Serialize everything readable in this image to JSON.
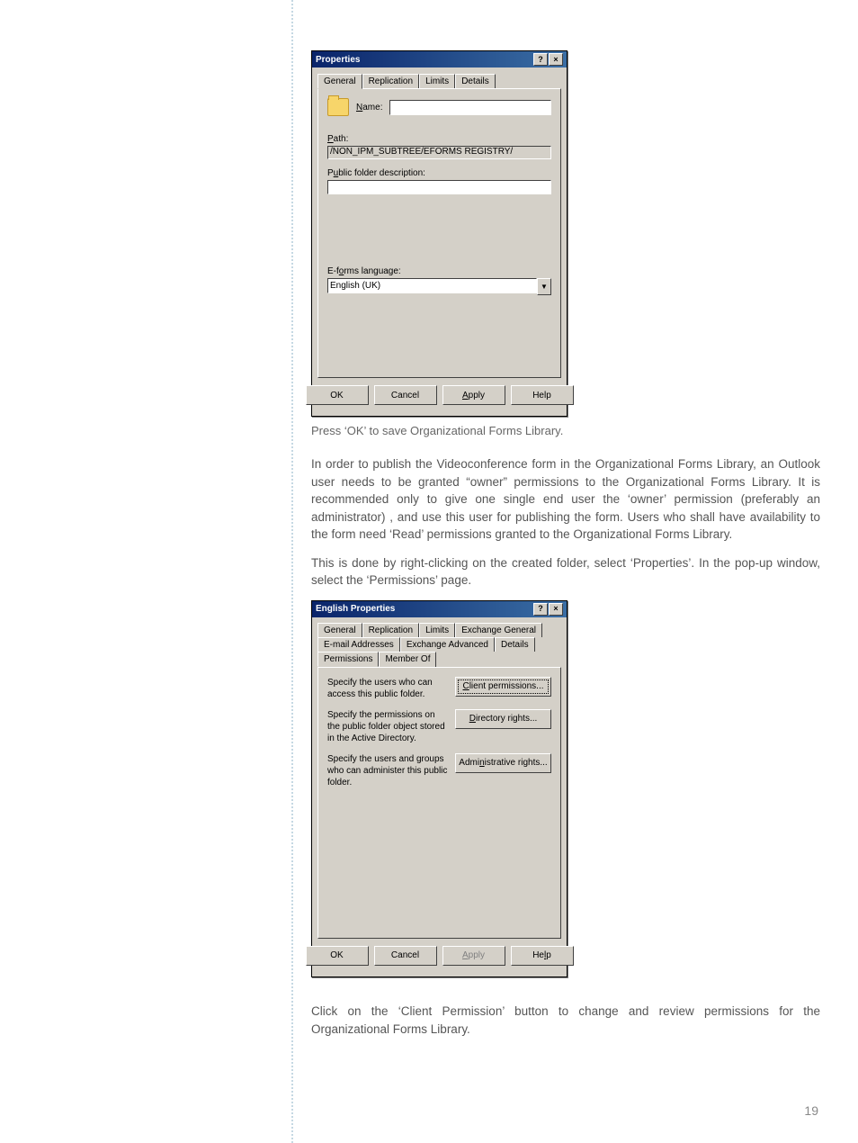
{
  "dialog1": {
    "title": "Properties",
    "tabs": [
      "General",
      "Replication",
      "Limits",
      "Details"
    ],
    "name_label": "Name:",
    "name_value": "",
    "path_label": "Path:",
    "path_value": "/NON_IPM_SUBTREE/EFORMS REGISTRY/",
    "desc_label": "Public folder description:",
    "desc_value": "",
    "lang_label": "E-forms language:",
    "lang_value": "English (UK)",
    "ok": "OK",
    "cancel": "Cancel",
    "apply": "Apply",
    "help": "Help"
  },
  "caption1": "Press ‘OK’ to save Organizational Forms Library.",
  "para1": "In order to publish the Videoconference form in the Organizational Forms Library, an Outlook user needs to be granted “owner” permissions to the Organizational Forms Library. It is recommended only to give one single end user the ‘owner’ permission (preferably an administrator) , and use this user for publishing the form. Users who shall have availability to the form need ‘Read’ permissions granted to the Organizational Forms Library.",
  "para2": "This is done by right-clicking on the created folder, select ‘Properties’. In the pop-up window, select the ‘Permissions’ page.",
  "dialog2": {
    "title": "English Properties",
    "tabs_row1": [
      "General",
      "Replication",
      "Limits",
      "Exchange General"
    ],
    "tabs_row2": [
      "E-mail Addresses",
      "Exchange Advanced",
      "Details",
      "Permissions",
      "Member Of"
    ],
    "row1_text": "Specify the users who can access this public folder.",
    "row1_btn": "Client permissions...",
    "row2_text": "Specify the permissions on the public folder object stored in the Active Directory.",
    "row2_btn": "Directory rights...",
    "row3_text": "Specify the users and groups who can administer this public folder.",
    "row3_btn": "Administrative rights...",
    "ok": "OK",
    "cancel": "Cancel",
    "apply": "Apply",
    "help": "Help"
  },
  "para3": "Click on the ‘Client Permission’ button to change and review permissions for the Organizational Forms Library.",
  "page_number": "19"
}
